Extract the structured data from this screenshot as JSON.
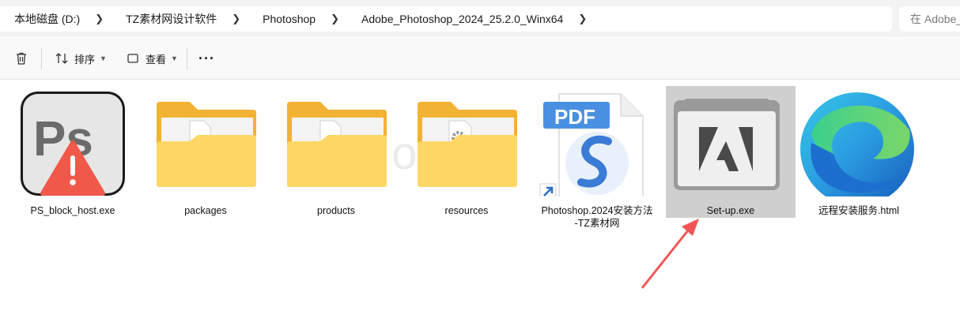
{
  "breadcrumb": {
    "items": [
      "本地磁盘 (D:)",
      "TZ素材网设计软件",
      "Photoshop",
      "Adobe_Photoshop_2024_25.2.0_Winx64"
    ]
  },
  "search": {
    "placeholder": "在 Adobe_"
  },
  "toolbar": {
    "delete_icon": "trash-icon",
    "sort_label": "排序",
    "view_label": "查看",
    "more_label": "···"
  },
  "files": [
    {
      "name": "PS_block_host.exe",
      "icon": "photoshop-warning-icon"
    },
    {
      "name": "packages",
      "icon": "folder-icon"
    },
    {
      "name": "products",
      "icon": "folder-icon"
    },
    {
      "name": "resources",
      "icon": "folder-settings-icon"
    },
    {
      "name_line1": "Photoshop.2024安装方法",
      "name_line2": "-TZ素材网",
      "icon": "pdf-shortcut-icon"
    },
    {
      "name": "Set-up.exe",
      "icon": "adobe-installer-icon",
      "selected": true
    },
    {
      "name": "远程安装服务.html",
      "icon": "edge-icon"
    }
  ],
  "watermark": "IAIMode",
  "colors": {
    "folder": "#f7c844",
    "folder_light": "#ffdf7a",
    "warning_red": "#f0584a",
    "pdf_blue": "#4a90e2",
    "selection": "#cfcfcf",
    "annotation_arrow": "#f25555"
  }
}
